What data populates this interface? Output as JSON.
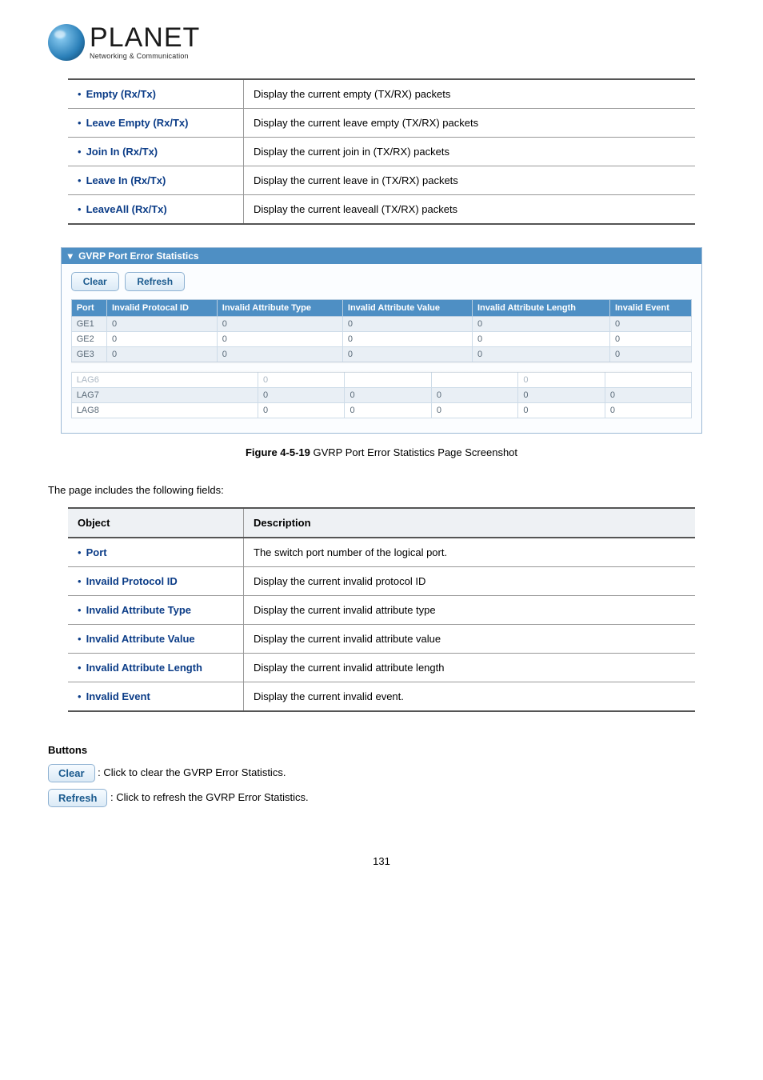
{
  "logo": {
    "brand": "PLANET",
    "tagline": "Networking & Communication"
  },
  "table1": {
    "rows": [
      {
        "obj": "Empty (Rx/Tx)",
        "desc": "Display the current empty (TX/RX) packets"
      },
      {
        "obj": "Leave Empty (Rx/Tx)",
        "desc": "Display the current leave empty (TX/RX) packets"
      },
      {
        "obj": "Join In (Rx/Tx)",
        "desc": "Display the current join in (TX/RX) packets"
      },
      {
        "obj": "Leave In (Rx/Tx)",
        "desc": "Display the current leave in (TX/RX) packets"
      },
      {
        "obj": "LeaveAll (Rx/Tx)",
        "desc": "Display the current leaveall (TX/RX) packets"
      }
    ]
  },
  "panel": {
    "title": "GVRP Port Error Statistics",
    "clear": "Clear",
    "refresh": "Refresh",
    "headers": [
      "Port",
      "Invalid Protocal ID",
      "Invalid Attribute Type",
      "Invalid Attribute Value",
      "Invalid Attribute Length",
      "Invalid Event"
    ],
    "rows_top": [
      {
        "c": [
          "GE1",
          "0",
          "0",
          "0",
          "0",
          "0"
        ],
        "alt": true
      },
      {
        "c": [
          "GE2",
          "0",
          "0",
          "0",
          "0",
          "0"
        ],
        "alt": false
      },
      {
        "c": [
          "GE3",
          "0",
          "0",
          "0",
          "0",
          "0"
        ],
        "alt": true
      }
    ],
    "rows_bottom": [
      {
        "c": [
          "LAG6",
          "0",
          "",
          "",
          "0",
          ""
        ],
        "alt": false,
        "faint": true
      },
      {
        "c": [
          "LAG7",
          "0",
          "0",
          "0",
          "0",
          "0"
        ],
        "alt": true
      },
      {
        "c": [
          "LAG8",
          "0",
          "0",
          "0",
          "0",
          "0"
        ],
        "alt": false
      }
    ]
  },
  "figcap": {
    "bold": "Figure 4-5-19",
    "rest": " GVRP Port Error Statistics Page Screenshot"
  },
  "intro2": "The page includes the following fields:",
  "table2": {
    "head_obj": "Object",
    "head_desc": "Description",
    "rows": [
      {
        "obj": "Port",
        "desc": "The switch port number of the logical port."
      },
      {
        "obj": "Invaild Protocol ID",
        "desc": "Display the current invalid protocol ID"
      },
      {
        "obj": "Invalid Attribute Type",
        "desc": "Display the current invalid attribute type"
      },
      {
        "obj": "Invalid Attribute Value",
        "desc": "Display the current invalid attribute value"
      },
      {
        "obj": "Invalid Attribute Length",
        "desc": "Display the current invalid attribute length"
      },
      {
        "obj": "Invalid Event",
        "desc": "Display the current invalid event."
      }
    ]
  },
  "buttons_section": {
    "heading": "Buttons",
    "clear_btn": "Clear",
    "clear_txt": ": Click to clear the GVRP Error Statistics.",
    "refresh_btn": "Refresh",
    "refresh_txt": ": Click to refresh the GVRP Error Statistics."
  },
  "page_number": "131"
}
